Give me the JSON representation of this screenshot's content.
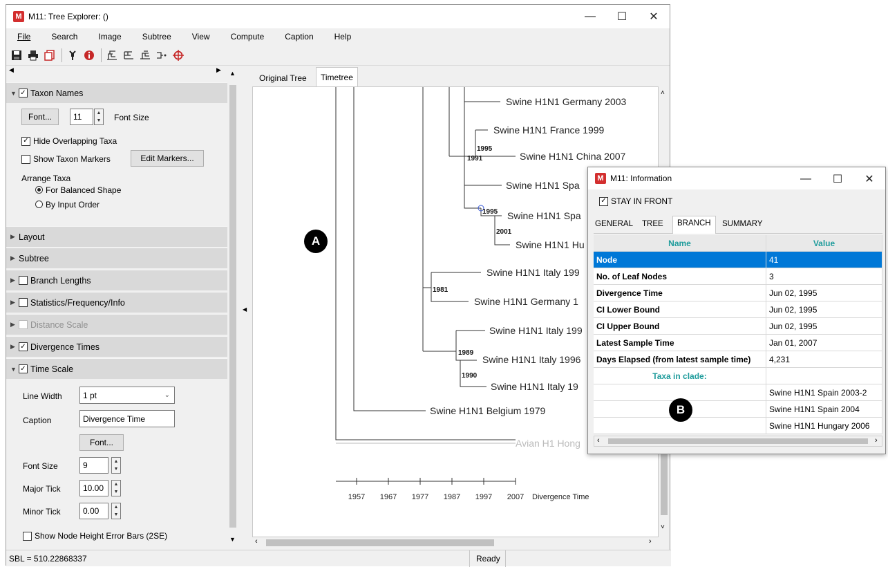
{
  "main_window": {
    "title": "M11: Tree Explorer: ()",
    "logo": "M",
    "controls": {
      "minimize": "—",
      "maximize": "☐",
      "close": "✕"
    }
  },
  "menu": [
    "File",
    "Search",
    "Image",
    "Subtree",
    "View",
    "Compute",
    "Caption",
    "Help"
  ],
  "toolbar_icons": [
    "save-icon",
    "print-icon",
    "copy-icon",
    "wrench-icon",
    "info-icon",
    "tree-icon-1",
    "tree-icon-2",
    "tree-icon-3",
    "tree-icon-4",
    "target-icon"
  ],
  "left_panel": {
    "taxon_names": {
      "label": "Taxon Names",
      "font_button": "Font...",
      "font_size_value": "11",
      "font_size_label": "Font Size",
      "hide_overlapping": "Hide Overlapping Taxa",
      "show_markers": "Show Taxon Markers",
      "edit_markers": "Edit Markers...",
      "arrange_label": "Arrange Taxa",
      "balanced": "For Balanced Shape",
      "input_order": "By Input Order"
    },
    "sections": {
      "layout": "Layout",
      "subtree": "Subtree",
      "branch_lengths": "Branch Lengths",
      "statistics": "Statistics/Frequency/Info",
      "distance_scale": "Distance Scale",
      "divergence_times": "Divergence Times",
      "time_scale": "Time Scale"
    },
    "time_scale": {
      "line_width_label": "Line Width",
      "line_width_value": "1 pt",
      "caption_label": "Caption",
      "caption_value": "Divergence Time",
      "font_button": "Font...",
      "font_size_label": "Font Size",
      "font_size_value": "9",
      "major_tick_label": "Major Tick",
      "major_tick_value": "10.00",
      "minor_tick_label": "Minor Tick",
      "minor_tick_value": "0.00",
      "error_bars": "Show Node Height Error Bars (2SE)"
    }
  },
  "tabs": [
    "Original Tree",
    "Timetree"
  ],
  "tree": {
    "taxa": [
      "Swine H1N1 Germany 2003",
      "Swine H1N1 France 1999",
      "Swine H1N1 China 2007",
      "Swine H1N1 Spa",
      "Swine H1N1 Spa",
      "Swine H1N1 Hu",
      "Swine H1N1 Italy 199",
      "Swine H1N1 Germany 1",
      "Swine H1N1 Italy 199",
      "Swine H1N1 Italy 1996",
      "Swine H1N1 Italy 19",
      "Swine H1N1 Belgium 1979",
      "Avian H1 Hong"
    ],
    "node_labels": [
      "1995",
      "1991",
      "1995",
      "2001",
      "1981",
      "1989",
      "1990"
    ],
    "scale_ticks": [
      "1957",
      "1967",
      "1977",
      "1987",
      "1997",
      "2007"
    ],
    "scale_caption": "Divergence Time"
  },
  "badges": {
    "a": "A",
    "b": "B"
  },
  "status": {
    "sbl": "SBL = 510.22868337",
    "state": "Ready"
  },
  "info_window": {
    "title": "M11: Information",
    "stay_in_front": "STAY IN FRONT",
    "tabs": [
      "GENERAL",
      "TREE",
      "BRANCH",
      "SUMMARY"
    ],
    "headers": {
      "name": "Name",
      "value": "Value"
    },
    "rows": [
      {
        "name": "Node",
        "value": "41"
      },
      {
        "name": "No. of Leaf Nodes",
        "value": "3"
      },
      {
        "name": "Divergence Time",
        "value": "Jun 02, 1995"
      },
      {
        "name": "CI Lower Bound",
        "value": "Jun 02, 1995"
      },
      {
        "name": "CI Upper Bound",
        "value": "Jun 02, 1995"
      },
      {
        "name": "Latest Sample Time",
        "value": "Jan 01, 2007"
      },
      {
        "name": "Days Elapsed (from latest sample time)",
        "value": "4,231"
      }
    ],
    "taxa_header": "Taxa in clade:",
    "taxa": [
      "Swine H1N1 Spain 2003-2",
      "Swine H1N1 Spain 2004",
      "Swine H1N1 Hungary 2006"
    ]
  },
  "colors": {
    "accent": "#0078d7",
    "logo": "#d32f2f",
    "info_header_text": "#1f9c9c"
  }
}
